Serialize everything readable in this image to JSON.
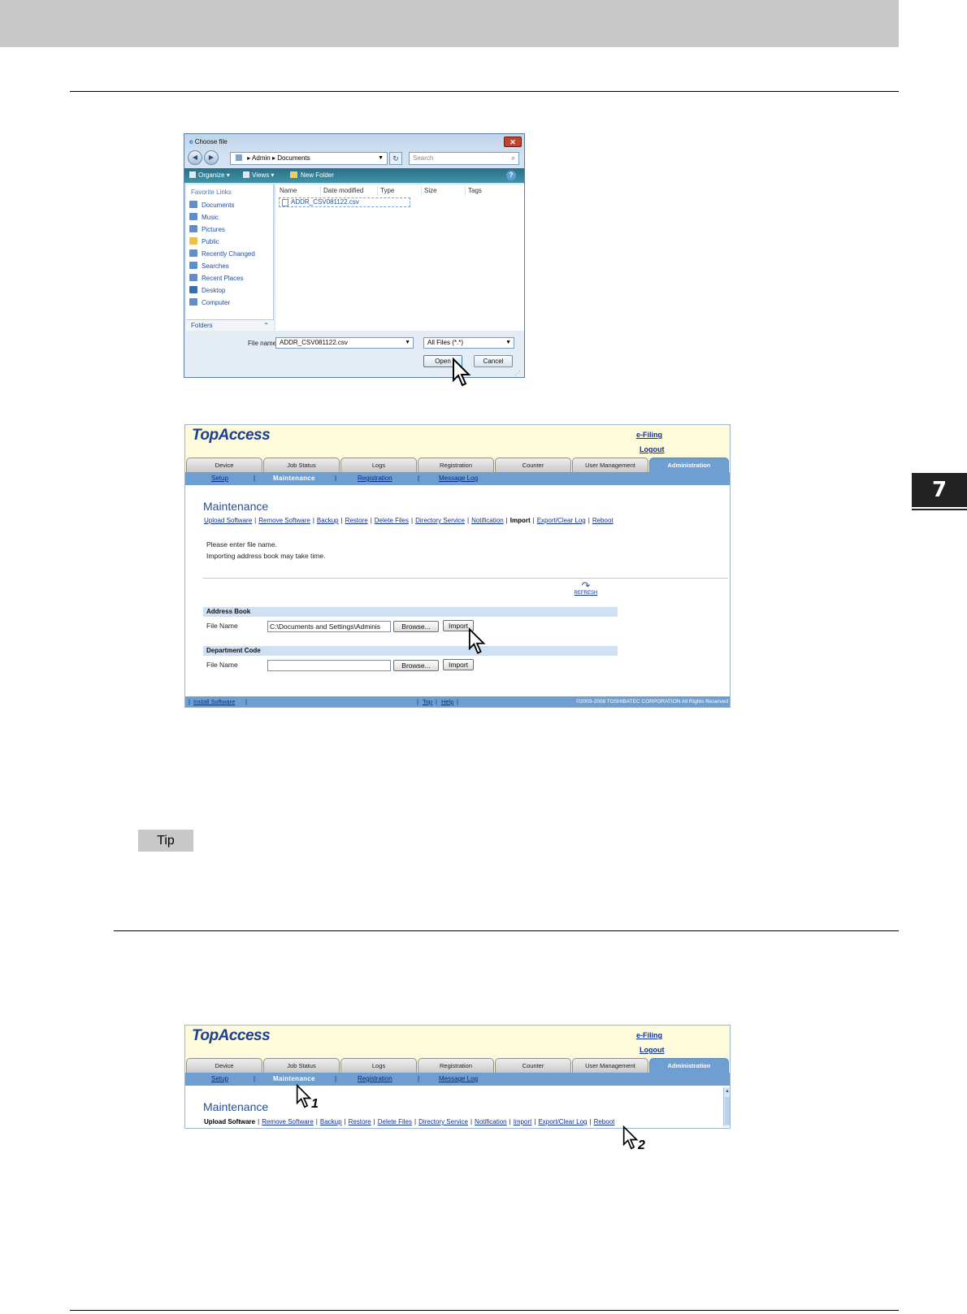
{
  "page": {
    "chapter": "7",
    "tip_label": "Tip"
  },
  "dialog": {
    "title": "Choose file",
    "breadcrumb": [
      "Admin",
      "Documents"
    ],
    "search_placeholder": "Search",
    "toolbar": {
      "organize": "Organize",
      "views": "Views",
      "new_folder": "New Folder",
      "help": "?"
    },
    "favorites_header": "Favorite Links",
    "favorites": [
      "Documents",
      "Music",
      "Pictures",
      "Public",
      "Recently Changed",
      "Searches",
      "Recent Places",
      "Desktop",
      "Computer"
    ],
    "folders_label": "Folders",
    "columns": [
      "Name",
      "Date modified",
      "Type",
      "Size",
      "Tags"
    ],
    "files": [
      "ADDR_CSV081122.csv"
    ],
    "file_name_label": "File name:",
    "file_name_value": "ADDR_CSV081122.csv",
    "file_type": "All Files (*.*)",
    "open_button": "Open",
    "cancel_button": "Cancel"
  },
  "topaccess_import": {
    "logo": "TopAccess",
    "links": {
      "efiling": "e-Filing",
      "logout": "Logout"
    },
    "tabs": [
      "Device",
      "Job Status",
      "Logs",
      "Registration",
      "Counter",
      "User Management",
      "Administration"
    ],
    "active_tab": "Administration",
    "subtabs": [
      "Setup",
      "Maintenance",
      "Registration",
      "Message Log"
    ],
    "current_subtab": "Maintenance",
    "page_title": "Maintenance",
    "menu": [
      "Upload Software",
      "Remove Software",
      "Backup",
      "Restore",
      "Delete Files",
      "Directory Service",
      "Notification",
      "Import",
      "Export/Clear Log",
      "Reboot"
    ],
    "current_menu": "Import",
    "message_line1": "Please enter file name.",
    "message_line2": "Importing address book may take time.",
    "refresh_label": "REFRESH",
    "address_book": {
      "header": "Address Book",
      "file_name_label": "File Name",
      "file_value": "C:\\Documents and Settings\\Adminis",
      "browse_button": "Browse...",
      "import_button": "Import"
    },
    "department_code": {
      "header": "Department Code",
      "file_name_label": "File Name",
      "file_value": "",
      "browse_button": "Browse...",
      "import_button": "Import"
    },
    "footer": {
      "install_software": "Install Software",
      "top": "Top",
      "help": "Help",
      "copyright": "©2003-2008 TOSHIBATEC CORPORATION All Rights Reserved"
    }
  },
  "topaccess_maintenance": {
    "logo": "TopAccess",
    "links": {
      "efiling": "e-Filing",
      "logout": "Logout"
    },
    "tabs": [
      "Device",
      "Job Status",
      "Logs",
      "Registration",
      "Counter",
      "User Management",
      "Administration"
    ],
    "active_tab": "Administration",
    "subtabs": [
      "Setup",
      "Maintenance",
      "Registration",
      "Message Log"
    ],
    "current_subtab": "Maintenance",
    "page_title": "Maintenance",
    "menu": [
      "Upload Software",
      "Remove Software",
      "Backup",
      "Restore",
      "Delete Files",
      "Directory Service",
      "Notification",
      "Import",
      "Export/Clear Log",
      "Reboot"
    ],
    "current_menu": "Upload Software",
    "steps": [
      "1",
      "2"
    ]
  }
}
